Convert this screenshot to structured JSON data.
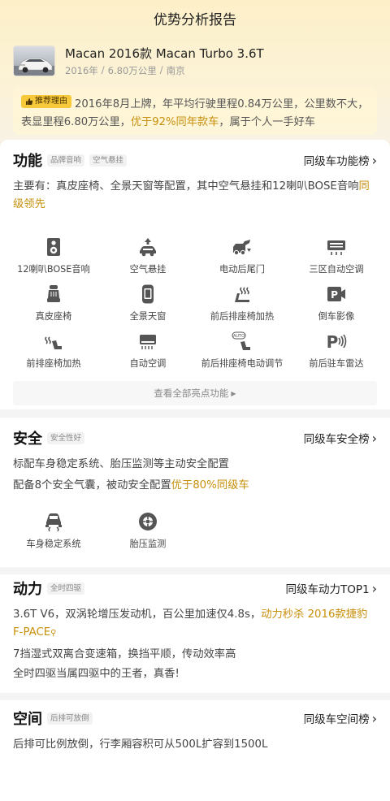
{
  "header": {
    "title": "优势分析报告"
  },
  "car": {
    "name": "Macan 2016款 Macan Turbo 3.6T",
    "year": "2016年",
    "mileage": "6.80万公里",
    "city": "南京",
    "separator": "/"
  },
  "reason": {
    "tag": "推荐理由",
    "text_1": "2016年8月上牌，年平均行驶里程0.84万公里，公里数不大，表显里程6.80万公里，",
    "highlight": "优于92%同年款车",
    "text_2": "，属于个人一手好车"
  },
  "features": {
    "title": "功能",
    "chips": [
      "品牌音响",
      "空气悬挂"
    ],
    "rank_link": "同级车功能榜",
    "desc_text": "主要有：真皮座椅、全景天窗等配置，其中空气悬挂和12喇叭BOSE音响",
    "desc_highlight": "同级领先",
    "items": [
      {
        "label": "12喇叭BOSE音响",
        "icon": "speaker-icon"
      },
      {
        "label": "空气悬挂",
        "icon": "air-suspension-icon"
      },
      {
        "label": "电动后尾门",
        "icon": "power-tailgate-icon"
      },
      {
        "label": "三区自动空调",
        "icon": "tri-zone-ac-icon"
      },
      {
        "label": "真皮座椅",
        "icon": "leather-seat-icon"
      },
      {
        "label": "全景天窗",
        "icon": "panoramic-sunroof-icon"
      },
      {
        "label": "前后排座椅加热",
        "icon": "rear-seat-heating-icon"
      },
      {
        "label": "倒车影像",
        "icon": "rear-camera-icon"
      },
      {
        "label": "前排座椅加热",
        "icon": "front-seat-heating-icon"
      },
      {
        "label": "自动空调",
        "icon": "auto-ac-icon"
      },
      {
        "label": "前后排座椅电动调节",
        "icon": "power-seat-adjust-icon"
      },
      {
        "label": "前后驻车雷达",
        "icon": "parking-radar-icon"
      }
    ],
    "more_label": "查看全部亮点功能"
  },
  "safety": {
    "title": "安全",
    "chip": "安全性好",
    "rank_link": "同级车安全榜",
    "line_1": "标配车身稳定系统、胎压监测等主动安全配置",
    "line_2_text": "配备8个安全气囊，被动安全配置",
    "line_2_highlight": "优于80%同级车",
    "items": [
      {
        "label": "车身稳定系统",
        "icon": "stability-control-icon"
      },
      {
        "label": "胎压监测",
        "icon": "tire-pressure-icon"
      }
    ]
  },
  "power": {
    "title": "动力",
    "chip": "全时四驱",
    "rank_link": "同级车动力TOP1",
    "line_1_text": "3.6T V6，双涡轮增压发动机，百公里加速仅4.8s，",
    "line_1_highlight": "动力秒杀 2016款捷豹F-PACE",
    "line_2": "7挡湿式双离合变速箱，换挡平顺，传动效率高",
    "line_3": "全时四驱当属四驱中的王者，真香!"
  },
  "space": {
    "title": "空间",
    "chip": "后排可放倒",
    "rank_link": "同级车空间榜",
    "line_1": "后排可比例放倒，行李厢容积可从500L扩容到1500L"
  },
  "colors": {
    "accent": "#c7900c",
    "tag_bg": "#f7c93a",
    "icon_gray": "#555555"
  }
}
